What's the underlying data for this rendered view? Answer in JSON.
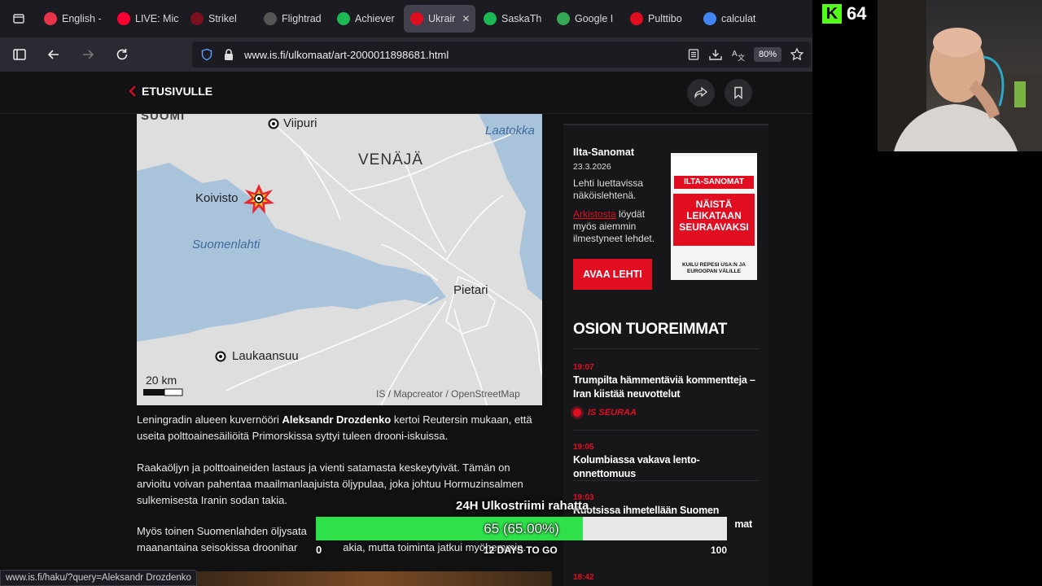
{
  "browser": {
    "tabs": [
      {
        "label": "English -",
        "color": "#e8344a",
        "active": false
      },
      {
        "label": "LIVE: Mic",
        "color": "#ff0033",
        "active": false
      },
      {
        "label": "Strikel",
        "color": "#7a1020",
        "active": false
      },
      {
        "label": "Flightrad",
        "color": "#555555",
        "active": false
      },
      {
        "label": "Achiever",
        "color": "#1db954",
        "active": false
      },
      {
        "label": "Ukrair",
        "color": "#e10e22",
        "active": true
      },
      {
        "label": "SaskaTh",
        "color": "#1db954",
        "active": false
      },
      {
        "label": "Google I",
        "color": "#34a853",
        "active": false
      },
      {
        "label": "Pulttibo",
        "color": "#e10e22",
        "active": false
      },
      {
        "label": "calculat",
        "color": "#4285f4",
        "active": false
      }
    ],
    "url": "www.is.fi/ulkomaat/art-2000011898681.html",
    "zoom": "80%",
    "status_url": "www.is.fi/haku/?query=Aleksandr Drozdenko"
  },
  "site": {
    "home_label": "ETUSIVULLE"
  },
  "map": {
    "labels": {
      "suomi": "SUOMI",
      "viipuri": "Viipuri",
      "laatokka": "Laatokka",
      "venaja": "VENÄJÄ",
      "koivisto": "Koivisto",
      "suomenlahti": "Suomenlahti",
      "pietari": "Pietari",
      "laukaansuu": "Laukaansuu",
      "scale": "20 km",
      "credit": "IS / Mapcreator / OpenStreetMap"
    }
  },
  "article": {
    "p1_pre": "Leningradin alueen kuvernööri",
    "p1_name": "Aleksandr Drozdenko",
    "p1_post": "kertoi Reutersin mukaan, että useita polttoainesäiliöitä Primorskissa syttyi tuleen drooni-iskuissa.",
    "p2": "Raakaöljyn ja polttoaineiden lastaus ja vienti satamasta keskeytyivät. Tämän on arvioitu voivan pahentaa maailmanlaajuista öljypulaa, joka johtuu Hormuzinsalmen sulkemisesta Iranin sodan takia.",
    "p3_line1": "Myös toinen Suomenlahden öljysata",
    "p3_line2": "maanantaina seisokissa droonihar",
    "p3_line2b": "akia, mutta toiminta jatkui myöhemmin."
  },
  "sidebar": {
    "paper": {
      "title": "Ilta-Sanomat",
      "date": "23.3.2026",
      "desc": "Lehti luettavissa näköislehtenä.",
      "archive_link": "Arkistosta",
      "archive_text": "löydät myös aiemmin ilmestyneet lehdet.",
      "button": "AVAA LEHTI",
      "cover_masthead": "ILTA-SANOMAT",
      "cover_headline": "NÄISTÄ LEIKATAAN SEURAAVAKSI",
      "cover_sub": "KUILU REPESI USA:N JA EUROOPAN VÄLILLE"
    },
    "latest": {
      "heading": "OSION TUOREIMMAT",
      "items": [
        {
          "time": "19:07",
          "title": "Trumpilta hämmentäviä kommentteja – Iran kiistää neuvottelut",
          "tag": "IS SEURAA"
        },
        {
          "time": "19:05",
          "title": "Kolumbiassa vakava lento-onnettomuus"
        },
        {
          "time": "19:03",
          "title": "Ruotsissa ihmetellään Suomen"
        },
        {
          "time": "18:42",
          "title": ""
        }
      ],
      "item3_trail": "mat"
    }
  },
  "overlay": {
    "goal_title": "24H Ulkostriimi rahatta",
    "goal_value": "65 (65.00%)",
    "goal_fraction": 0.65,
    "goal_min": "0",
    "goal_days": "12 DAYS TO GO",
    "goal_max": "100"
  },
  "webcam": {
    "viewer_count": "64",
    "platform_logo": "K"
  },
  "colors": {
    "brand_red": "#e10e22",
    "goal_green": "#2ee04a",
    "kick_green": "#53fc18"
  }
}
